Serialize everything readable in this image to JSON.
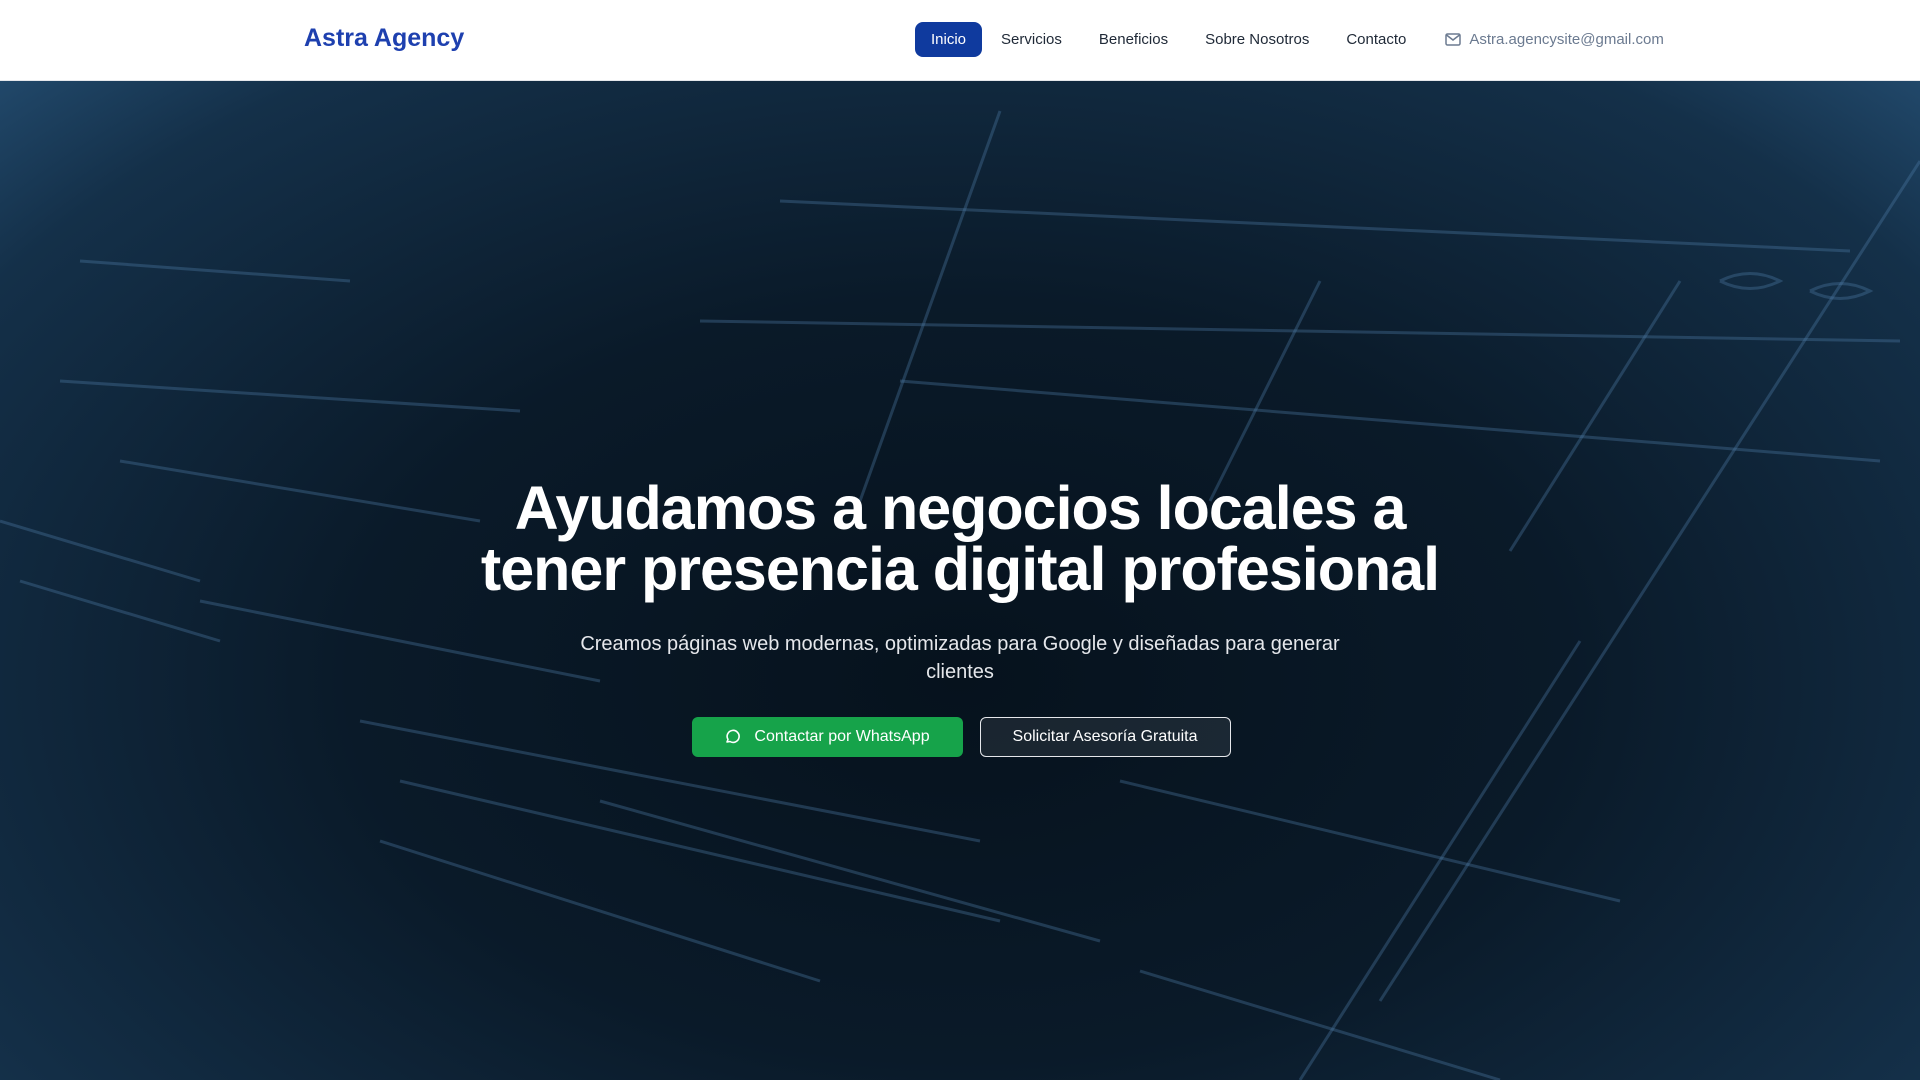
{
  "header": {
    "logo": "Astra Agency",
    "nav": [
      {
        "label": "Inicio",
        "active": true
      },
      {
        "label": "Servicios"
      },
      {
        "label": "Beneficios"
      },
      {
        "label": "Sobre Nosotros"
      },
      {
        "label": "Contacto"
      }
    ],
    "email": "Astra.agencysite@gmail.com",
    "accent": "#1e40af"
  },
  "hero": {
    "title_line1": "Ayudamos a negocios locales a",
    "title_line2": "tener presencia digital profesional",
    "subtitle": "Creamos páginas web modernas, optimizadas para Google y diseñadas para generar clientes",
    "whatsapp_button": "Contactar por WhatsApp",
    "consult_button": "Solicitar Asesoría Gratuita",
    "whatsapp_color": "#16a34a"
  }
}
